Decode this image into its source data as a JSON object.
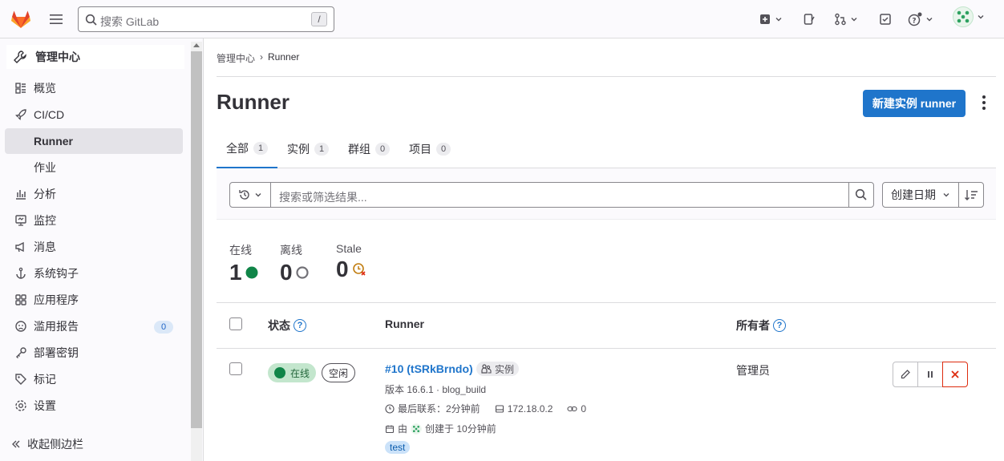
{
  "topbar": {
    "search_placeholder": "搜索 GitLab",
    "search_shortcut": "/",
    "icons": [
      "plus-square-icon",
      "issues-icon",
      "merge-request-icon",
      "todo-icon",
      "help-icon",
      "avatar"
    ]
  },
  "sidebar": {
    "header": "管理中心",
    "items": [
      {
        "label": "概览",
        "icon": "overview-icon"
      },
      {
        "label": "CI/CD",
        "icon": "rocket-icon"
      },
      {
        "label": "Runner",
        "sub": true,
        "active": true
      },
      {
        "label": "作业",
        "sub": true
      },
      {
        "label": "分析",
        "icon": "chart-icon"
      },
      {
        "label": "监控",
        "icon": "monitor-icon"
      },
      {
        "label": "消息",
        "icon": "bullhorn-icon"
      },
      {
        "label": "系统钩子",
        "icon": "anchor-icon"
      },
      {
        "label": "应用程序",
        "icon": "apps-icon"
      },
      {
        "label": "滥用报告",
        "icon": "abuse-icon",
        "badge": "0"
      },
      {
        "label": "部署密钥",
        "icon": "key-icon"
      },
      {
        "label": "标记",
        "icon": "label-icon"
      },
      {
        "label": "设置",
        "icon": "settings-icon"
      }
    ],
    "collapse_label": "收起侧边栏"
  },
  "breadcrumb": {
    "root": "管理中心",
    "sep": "›",
    "current": "Runner"
  },
  "page": {
    "title": "Runner",
    "new_button": "新建实例 runner"
  },
  "tabs": [
    {
      "label": "全部",
      "count": "1"
    },
    {
      "label": "实例",
      "count": "1"
    },
    {
      "label": "群组",
      "count": "0"
    },
    {
      "label": "项目",
      "count": "0"
    }
  ],
  "filter": {
    "placeholder": "搜索或筛选结果...",
    "sort_label": "创建日期"
  },
  "stats": {
    "online": {
      "label": "在线",
      "value": "1"
    },
    "offline": {
      "label": "离线",
      "value": "0"
    },
    "stale": {
      "label": "Stale",
      "value": "0"
    }
  },
  "table": {
    "headers": {
      "status": "状态",
      "runner": "Runner",
      "owner": "所有者"
    },
    "rows": [
      {
        "status_online": "在线",
        "status_idle": "空闲",
        "runner_name": "#10 (tSRkBrndo)",
        "runner_type": "实例",
        "version_line": "版本 16.6.1 · blog_build",
        "last_contact": "最后联系：2分钟前",
        "ip": "172.18.0.2",
        "jobs": "0",
        "created_by": "由",
        "created_at": "创建于 10分钟前",
        "tag": "test",
        "owner": "管理员"
      }
    ]
  },
  "colors": {
    "primary": "#1f75cb",
    "online": "#108548",
    "danger": "#dd2b0e",
    "stale": "#c17d10"
  }
}
